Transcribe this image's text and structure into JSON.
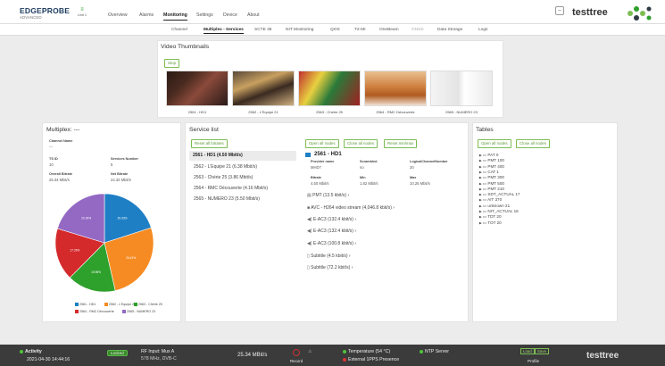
{
  "brand": {
    "name": "EDGEPROBE",
    "sub": "ADVANCED",
    "unit": "Unit 1"
  },
  "nav": [
    "Overview",
    "Alarms",
    "Monitoring",
    "Settings",
    "Device",
    "About"
  ],
  "nav_active": "Monitoring",
  "logo": "testtree",
  "subnav": [
    "Channel",
    "Multiplex - Services",
    "SCTE 35",
    "NIT Monitoring",
    "QOS",
    "T2-MI",
    "OneBeam",
    "GNSS",
    "Data Storage",
    "Logs"
  ],
  "video": {
    "title": "Video Thumbnails",
    "stop": "Stop",
    "thumbs": [
      "2561 - HD1",
      "2562 - L'Equipe 21",
      "2563 - Chérie 25",
      "2564 - RMC Découverte",
      "2565 - NUMERO 23"
    ]
  },
  "multiplex": {
    "title": "Multiplex: ---",
    "channel_name_label": "Channel Name",
    "channel_name": "---",
    "ts_id_label": "TS ID",
    "ts_id": "10",
    "services_number_label": "Services Number",
    "services_number": "5",
    "overall_bitrate_label": "Overall Bitrate",
    "overall_bitrate": "25.34 Mbit/s",
    "net_bitrate_label": "Net Bitrate",
    "net_bitrate": "24.32 Mbit/s"
  },
  "chart_data": {
    "type": "pie",
    "categories": [
      "2561 - HD1",
      "2562 - L'Equipe 21",
      "2563 - Chérie 25",
      "2564 - RMC Découverte",
      "2565 - NUMERO 23"
    ],
    "values": [
      20.03,
      26.43,
      15.98,
      17.26,
      20.3
    ],
    "labels": [
      "20.03%",
      "26.43%",
      "15.98%",
      "17.26%",
      "20.30%"
    ],
    "colors": [
      "#1f7fc4",
      "#f58b22",
      "#2ea02c",
      "#d42a2c",
      "#9369c4"
    ]
  },
  "services": {
    "title": "Service list",
    "reset": "Reset all bitrates",
    "items": [
      "2561 - HD1 (4.50 Mbit/s)",
      "2562 - L'Equipe 21 (6.38 Mbit/s)",
      "2563 - Chérie 25 (3.86 Mbit/s)",
      "2564 - RMC Découverte (4.16 Mbit/s)",
      "2565 - NUMERO 23 (5.50 Mbit/s)"
    ]
  },
  "detail": {
    "open_all": "Open all nodes",
    "close_all": "Close all nodes",
    "reset_min_max": "Reset min/max",
    "service": "2561 - HD1",
    "provider_label": "Provider name",
    "provider": "MHD7",
    "scrambled_label": "Scrambled",
    "scrambled": "no",
    "lcn_label": "LogicalChannelNumber",
    "lcn": "20",
    "bitrate_label": "Bitrate",
    "bitrate": "4.50 Mbit/s",
    "min_label": "Min",
    "min": "1.82 Mbit/s",
    "max_label": "Max",
    "max": "10.25 Mbit/s",
    "nodes": [
      "PMT (13.5 kbit/s)",
      "AVC - H264 video stream (4,046.8 kbit/s)",
      "E-AC3 (132.4 kbit/s)",
      "E-AC3 (132.4 kbit/s)",
      "E-AC3 (100.8 kbit/s)",
      "Subtitle (4.5 kbit/s)",
      "Subtitle (72.2 kbit/s)"
    ]
  },
  "tables": {
    "title": "Tables",
    "open_all": "Open all nodes",
    "close_all": "Close all nodes",
    "items": [
      "PAT 0",
      "PMT 100",
      "PMT 400",
      "CAT 1",
      "PMT 300",
      "PMT 500",
      "PMT 210",
      "SDT_ACTUAL 17",
      "AIT 370",
      "unknown 21",
      "NIT_ACTUAL 16",
      "TDT 20",
      "TOT 20"
    ]
  },
  "footer": {
    "activity_label": "Activity",
    "datetime": "2021-04-30 14:44:16",
    "locked": "Locked",
    "rf_input": "RF Input: Mux A",
    "freq": "578 MHz, DVB-C",
    "bitrate": "25.34 MBit/s",
    "record": "Record",
    "temperature": "Temperature (54 °C)",
    "pps": "External 1PPS Presence",
    "ntp": "NTP Server",
    "load": "Load",
    "save": "Save",
    "profile": "Profile",
    "logo": "testtree"
  }
}
